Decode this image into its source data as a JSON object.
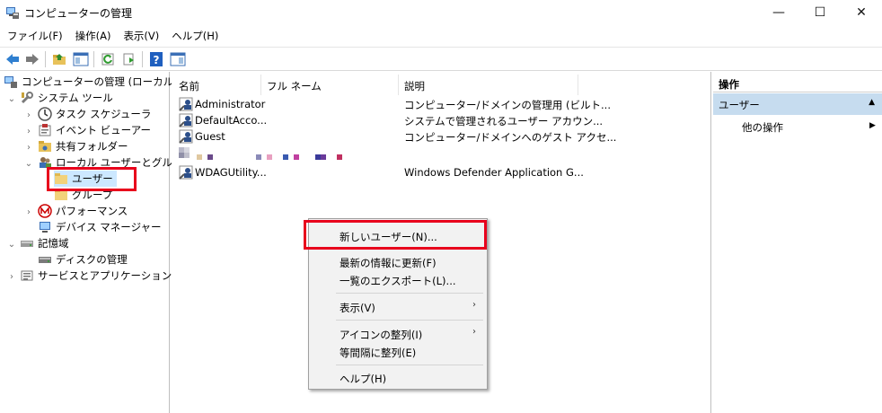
{
  "window": {
    "title": "コンピューターの管理",
    "controls": {
      "minimize": "—",
      "maximize": "☐",
      "close": "✕"
    }
  },
  "menu": [
    "ファイル(F)",
    "操作(A)",
    "表示(V)",
    "ヘルプ(H)"
  ],
  "toolbar": {
    "icons": [
      "back-arrow-icon",
      "forward-arrow-icon",
      "up-folder-icon",
      "show-hide-tree-icon",
      "refresh-icon",
      "export-list-icon",
      "help-icon",
      "show-hide-action-icon"
    ]
  },
  "tree": {
    "root": "コンピューターの管理 (ローカル)",
    "system_tools": "システム ツール",
    "task_scheduler": "タスク スケジューラ",
    "event_viewer": "イベント ビューアー",
    "shared_folders": "共有フォルダー",
    "local_users_groups": "ローカル ユーザーとグループ",
    "users": "ユーザー",
    "groups": "グループ",
    "performance": "パフォーマンス",
    "device_manager": "デバイス マネージャー",
    "storage": "記憶域",
    "disk_management": "ディスクの管理",
    "services_apps": "サービスとアプリケーション"
  },
  "list": {
    "columns": [
      "名前",
      "フル ネーム",
      "説明"
    ],
    "rows": [
      {
        "name": "Administrator",
        "description": "コンピューター/ドメインの管理用 (ビルト..."
      },
      {
        "name": "DefaultAcco...",
        "description": "システムで管理されるユーザー アカウン..."
      },
      {
        "name": "Guest",
        "description": "コンピューター/ドメインへのゲスト アクセ..."
      },
      {
        "name": "WDAGUtility...",
        "description": "Windows Defender Application G..."
      }
    ]
  },
  "actions": {
    "header": "操作",
    "section": "ユーザー",
    "more": "他の操作"
  },
  "context_menu": {
    "new_user": "新しいユーザー(N)...",
    "refresh": "最新の情報に更新(F)",
    "export_list": "一覧のエクスポート(L)...",
    "view": "表示(V)",
    "arrange_icons": "アイコンの整列(I)",
    "line_up_icons": "等間隔に整列(E)",
    "help": "ヘルプ(H)"
  },
  "colors": {
    "highlight_border": "#e8001c",
    "selected_section": "#c6dcef",
    "menu_background": "#f2f2f2"
  }
}
